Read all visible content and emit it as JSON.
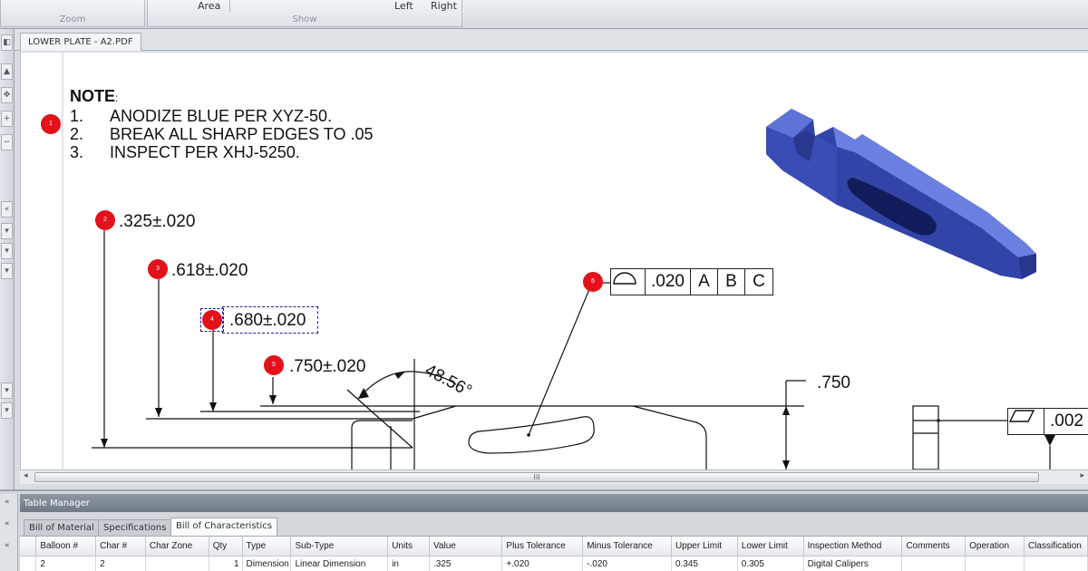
{
  "ribbon": {
    "zoom_label": "Zoom",
    "area_label": "Area",
    "left_label": "Left",
    "right_label": "Right",
    "show_label": "Show"
  },
  "document": {
    "tab_title": "LOWER PLATE - A2.PDF"
  },
  "drawing": {
    "note_title": "NOTE",
    "note_colon": ":",
    "notes": [
      {
        "num": "1.",
        "text": "ANODIZE BLUE PER XYZ-50."
      },
      {
        "num": "2.",
        "text": "BREAK ALL SHARP EDGES TO .05"
      },
      {
        "num": "3.",
        "text": "INSPECT PER XHJ-5250."
      }
    ],
    "balloons": [
      "1",
      "2",
      "3",
      "4",
      "5",
      "6"
    ],
    "dims": {
      "d2": ".325±.020",
      "d3": ".618±.020",
      "d4": ".680±.020",
      "d5": ".750±.020",
      "angle": "48.56°",
      "height": ".750"
    },
    "fcf1": {
      "tol": ".020",
      "datums": [
        "A",
        "B",
        "C"
      ]
    },
    "fcf2": {
      "tol": ".002"
    },
    "accent_color": "#e4101a",
    "part_color": "#3b4cb8"
  },
  "scrollbar": {
    "grip": "III"
  },
  "table_manager": {
    "title": "Table Manager",
    "tabs": [
      "Bill of Material",
      "Specifications",
      "Bill of Characteristics"
    ],
    "active_tab": "Bill of Characteristics",
    "columns": [
      "Balloon #",
      "Char #",
      "Char Zone",
      "Qty",
      "Type",
      "Sub-Type",
      "Units",
      "Value",
      "Plus Tolerance",
      "Minus Tolerance",
      "Upper Limit",
      "Lower Limit",
      "Inspection Method",
      "Comments",
      "Operation",
      "Classification"
    ],
    "rows": [
      [
        "2",
        "2",
        "",
        "1",
        "Dimension",
        "Linear Dimension",
        "in",
        ".325",
        "+.020",
        "-.020",
        "0.345",
        "0.305",
        "Digital Calipers",
        "",
        "",
        ""
      ]
    ]
  }
}
